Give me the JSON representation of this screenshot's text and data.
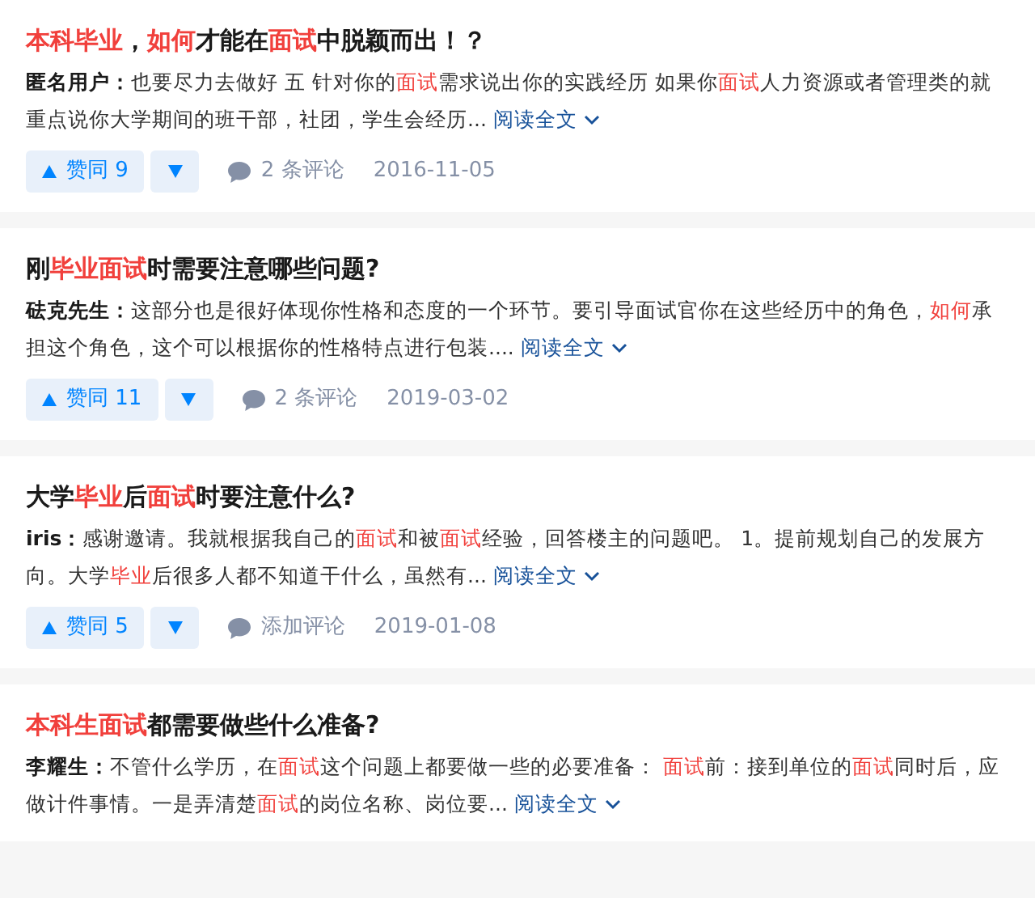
{
  "results": [
    {
      "title": [
        {
          "text": "本科毕业",
          "highlight": true
        },
        {
          "text": "，",
          "highlight": false
        },
        {
          "text": "如何",
          "highlight": true
        },
        {
          "text": "才能在",
          "highlight": false
        },
        {
          "text": "面试",
          "highlight": true
        },
        {
          "text": "中脱颖而出！？",
          "highlight": false
        }
      ],
      "author": "匿名用户：",
      "excerpt": [
        {
          "text": "也要尽力去做好 五 针对你的",
          "highlight": false
        },
        {
          "text": "面试",
          "highlight": true
        },
        {
          "text": "需求说出你的实践经历 如果你",
          "highlight": false
        },
        {
          "text": "面试",
          "highlight": true
        },
        {
          "text": "人力资源或者管理类的就重点说你大学期间的班干部，社团，学生会经历...",
          "highlight": false
        }
      ],
      "read_more": "阅读全文",
      "upvote": "赞同 9",
      "comments": "2 条评论",
      "date": "2016-11-05"
    },
    {
      "title": [
        {
          "text": "刚",
          "highlight": false
        },
        {
          "text": "毕业面试",
          "highlight": true
        },
        {
          "text": "时需要注意哪些问题?",
          "highlight": false
        }
      ],
      "author": "砝克先生：",
      "excerpt": [
        {
          "text": "这部分也是很好体现你性格和态度的一个环节。要引导面试官你在这些经历中的角色，",
          "highlight": false
        },
        {
          "text": "如何",
          "highlight": true
        },
        {
          "text": "承担这个角色，这个可以根据你的性格特点进行包装....",
          "highlight": false
        }
      ],
      "read_more": "阅读全文",
      "upvote": "赞同 11",
      "comments": "2 条评论",
      "date": "2019-03-02"
    },
    {
      "title": [
        {
          "text": "大学",
          "highlight": false
        },
        {
          "text": "毕业",
          "highlight": true
        },
        {
          "text": "后",
          "highlight": false
        },
        {
          "text": "面试",
          "highlight": true
        },
        {
          "text": "时要注意什么?",
          "highlight": false
        }
      ],
      "author": "iris：",
      "excerpt": [
        {
          "text": "感谢邀请。我就根据我自己的",
          "highlight": false
        },
        {
          "text": "面试",
          "highlight": true
        },
        {
          "text": "和被",
          "highlight": false
        },
        {
          "text": "面试",
          "highlight": true
        },
        {
          "text": "经验，回答楼主的问题吧。 1。提前规划自己的发展方向。大学",
          "highlight": false
        },
        {
          "text": "毕业",
          "highlight": true
        },
        {
          "text": "后很多人都不知道干什么，虽然有...",
          "highlight": false
        }
      ],
      "read_more": "阅读全文",
      "upvote": "赞同 5",
      "comments": "添加评论",
      "date": "2019-01-08"
    },
    {
      "title": [
        {
          "text": "本科生面试",
          "highlight": true
        },
        {
          "text": "都需要做些什么准备?",
          "highlight": false
        }
      ],
      "author": "李耀生：",
      "excerpt": [
        {
          "text": "不管什么学历，在",
          "highlight": false
        },
        {
          "text": "面试",
          "highlight": true
        },
        {
          "text": "这个问题上都要做一些的必要准备： ",
          "highlight": false
        },
        {
          "text": "面试",
          "highlight": true
        },
        {
          "text": "前：接到单位的",
          "highlight": false
        },
        {
          "text": "面试",
          "highlight": true
        },
        {
          "text": "同时后，应做计件事情。一是弄清楚",
          "highlight": false
        },
        {
          "text": "面试",
          "highlight": true
        },
        {
          "text": "的岗位名称、岗位要...",
          "highlight": false
        }
      ],
      "read_more": "阅读全文"
    }
  ]
}
